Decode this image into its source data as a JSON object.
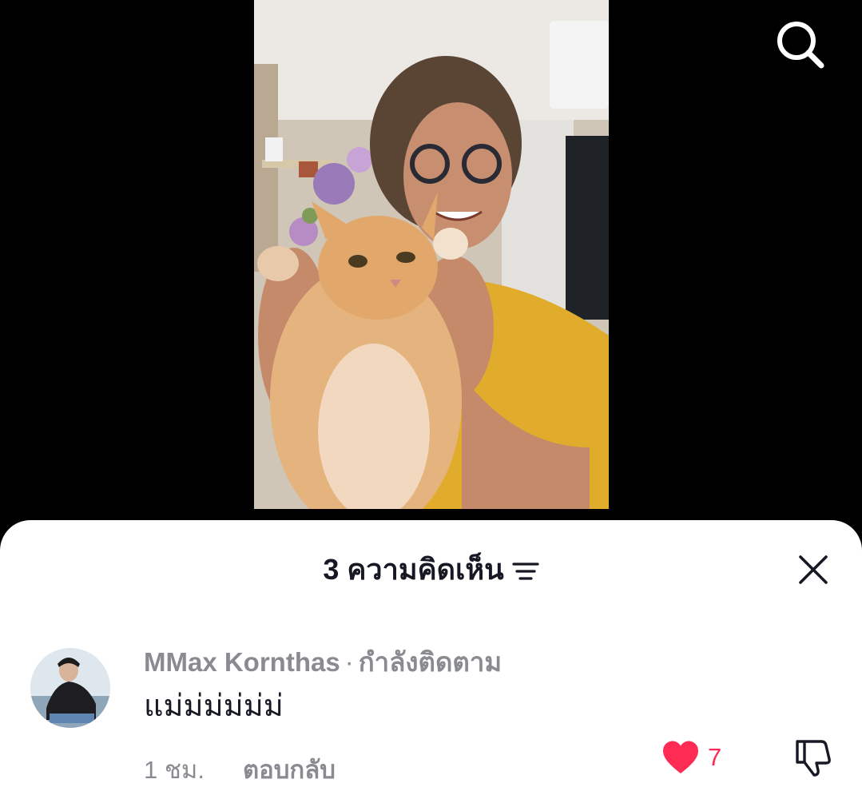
{
  "video": {
    "icon": "search-icon"
  },
  "comments_sheet": {
    "title": "3 ความคิดเห็น",
    "filter_icon": "filter-icon",
    "close_icon": "close-icon",
    "comments": [
      {
        "author": "MMax Kornthas",
        "separator": "·",
        "relation": "กำลังติดตาม",
        "text": "แม่ม่ม่ม่ม่ม่",
        "time": "1 ชม.",
        "reply_label": "ตอบกลับ",
        "likes": "7",
        "liked": true,
        "like_color": "#fe2c55"
      }
    ]
  }
}
